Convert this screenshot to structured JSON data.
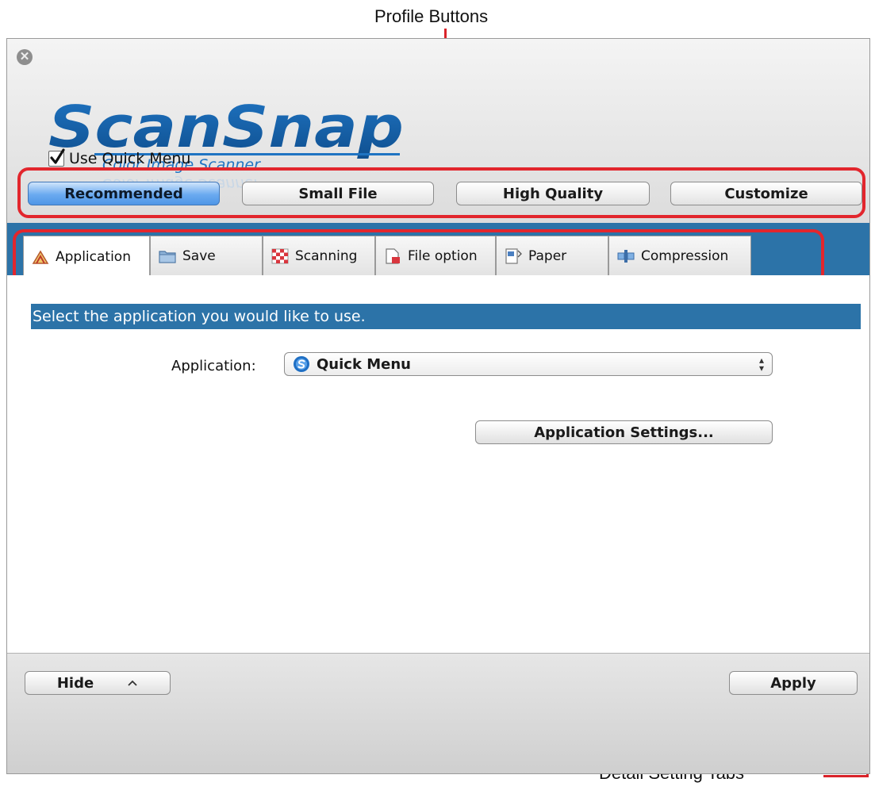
{
  "callouts": {
    "top": "Profile Buttons",
    "bottom": "Detail Setting Tabs"
  },
  "window": {
    "close_icon": "close-icon",
    "logo": {
      "main": "ScanSnap",
      "sub": "Color Image Scanner"
    },
    "use_quick_menu": {
      "label": "Use Quick Menu",
      "checked": true
    },
    "profiles": [
      {
        "label": "Recommended",
        "selected": true
      },
      {
        "label": "Small File",
        "selected": false
      },
      {
        "label": "High Quality",
        "selected": false
      },
      {
        "label": "Customize",
        "selected": false
      }
    ],
    "tabs": [
      {
        "label": "Application",
        "icon": "application-icon",
        "active": true
      },
      {
        "label": "Save",
        "icon": "folder-icon",
        "active": false
      },
      {
        "label": "Scanning",
        "icon": "scanning-icon",
        "active": false
      },
      {
        "label": "File option",
        "icon": "file-option-icon",
        "active": false
      },
      {
        "label": "Paper",
        "icon": "paper-icon",
        "active": false
      },
      {
        "label": "Compression",
        "icon": "compression-icon",
        "active": false
      }
    ],
    "content": {
      "section_title": "Select the application you would like to use.",
      "application_label": "Application:",
      "application_value": "Quick Menu",
      "application_settings_button": "Application Settings..."
    },
    "help_label": "?",
    "footer": {
      "hide_label": "Hide",
      "apply_label": "Apply"
    }
  },
  "colors": {
    "accent_blue": "#2c73a8",
    "callout_red": "#e2262d"
  }
}
